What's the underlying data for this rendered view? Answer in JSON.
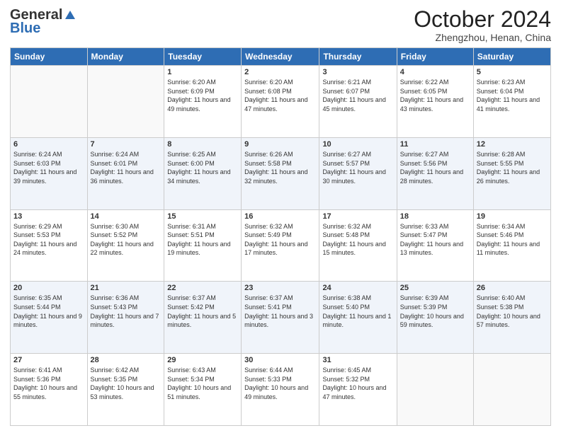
{
  "header": {
    "logo_line1": "General",
    "logo_line2": "Blue",
    "month": "October 2024",
    "location": "Zhengzhou, Henan, China"
  },
  "weekdays": [
    "Sunday",
    "Monday",
    "Tuesday",
    "Wednesday",
    "Thursday",
    "Friday",
    "Saturday"
  ],
  "weeks": [
    [
      {
        "day": "",
        "info": ""
      },
      {
        "day": "",
        "info": ""
      },
      {
        "day": "1",
        "sunrise": "6:20 AM",
        "sunset": "6:09 PM",
        "daylight": "11 hours and 49 minutes."
      },
      {
        "day": "2",
        "sunrise": "6:20 AM",
        "sunset": "6:08 PM",
        "daylight": "11 hours and 47 minutes."
      },
      {
        "day": "3",
        "sunrise": "6:21 AM",
        "sunset": "6:07 PM",
        "daylight": "11 hours and 45 minutes."
      },
      {
        "day": "4",
        "sunrise": "6:22 AM",
        "sunset": "6:05 PM",
        "daylight": "11 hours and 43 minutes."
      },
      {
        "day": "5",
        "sunrise": "6:23 AM",
        "sunset": "6:04 PM",
        "daylight": "11 hours and 41 minutes."
      }
    ],
    [
      {
        "day": "6",
        "sunrise": "6:24 AM",
        "sunset": "6:03 PM",
        "daylight": "11 hours and 39 minutes."
      },
      {
        "day": "7",
        "sunrise": "6:24 AM",
        "sunset": "6:01 PM",
        "daylight": "11 hours and 36 minutes."
      },
      {
        "day": "8",
        "sunrise": "6:25 AM",
        "sunset": "6:00 PM",
        "daylight": "11 hours and 34 minutes."
      },
      {
        "day": "9",
        "sunrise": "6:26 AM",
        "sunset": "5:58 PM",
        "daylight": "11 hours and 32 minutes."
      },
      {
        "day": "10",
        "sunrise": "6:27 AM",
        "sunset": "5:57 PM",
        "daylight": "11 hours and 30 minutes."
      },
      {
        "day": "11",
        "sunrise": "6:27 AM",
        "sunset": "5:56 PM",
        "daylight": "11 hours and 28 minutes."
      },
      {
        "day": "12",
        "sunrise": "6:28 AM",
        "sunset": "5:55 PM",
        "daylight": "11 hours and 26 minutes."
      }
    ],
    [
      {
        "day": "13",
        "sunrise": "6:29 AM",
        "sunset": "5:53 PM",
        "daylight": "11 hours and 24 minutes."
      },
      {
        "day": "14",
        "sunrise": "6:30 AM",
        "sunset": "5:52 PM",
        "daylight": "11 hours and 22 minutes."
      },
      {
        "day": "15",
        "sunrise": "6:31 AM",
        "sunset": "5:51 PM",
        "daylight": "11 hours and 19 minutes."
      },
      {
        "day": "16",
        "sunrise": "6:32 AM",
        "sunset": "5:49 PM",
        "daylight": "11 hours and 17 minutes."
      },
      {
        "day": "17",
        "sunrise": "6:32 AM",
        "sunset": "5:48 PM",
        "daylight": "11 hours and 15 minutes."
      },
      {
        "day": "18",
        "sunrise": "6:33 AM",
        "sunset": "5:47 PM",
        "daylight": "11 hours and 13 minutes."
      },
      {
        "day": "19",
        "sunrise": "6:34 AM",
        "sunset": "5:46 PM",
        "daylight": "11 hours and 11 minutes."
      }
    ],
    [
      {
        "day": "20",
        "sunrise": "6:35 AM",
        "sunset": "5:44 PM",
        "daylight": "11 hours and 9 minutes."
      },
      {
        "day": "21",
        "sunrise": "6:36 AM",
        "sunset": "5:43 PM",
        "daylight": "11 hours and 7 minutes."
      },
      {
        "day": "22",
        "sunrise": "6:37 AM",
        "sunset": "5:42 PM",
        "daylight": "11 hours and 5 minutes."
      },
      {
        "day": "23",
        "sunrise": "6:37 AM",
        "sunset": "5:41 PM",
        "daylight": "11 hours and 3 minutes."
      },
      {
        "day": "24",
        "sunrise": "6:38 AM",
        "sunset": "5:40 PM",
        "daylight": "11 hours and 1 minute."
      },
      {
        "day": "25",
        "sunrise": "6:39 AM",
        "sunset": "5:39 PM",
        "daylight": "10 hours and 59 minutes."
      },
      {
        "day": "26",
        "sunrise": "6:40 AM",
        "sunset": "5:38 PM",
        "daylight": "10 hours and 57 minutes."
      }
    ],
    [
      {
        "day": "27",
        "sunrise": "6:41 AM",
        "sunset": "5:36 PM",
        "daylight": "10 hours and 55 minutes."
      },
      {
        "day": "28",
        "sunrise": "6:42 AM",
        "sunset": "5:35 PM",
        "daylight": "10 hours and 53 minutes."
      },
      {
        "day": "29",
        "sunrise": "6:43 AM",
        "sunset": "5:34 PM",
        "daylight": "10 hours and 51 minutes."
      },
      {
        "day": "30",
        "sunrise": "6:44 AM",
        "sunset": "5:33 PM",
        "daylight": "10 hours and 49 minutes."
      },
      {
        "day": "31",
        "sunrise": "6:45 AM",
        "sunset": "5:32 PM",
        "daylight": "10 hours and 47 minutes."
      },
      {
        "day": "",
        "info": ""
      },
      {
        "day": "",
        "info": ""
      }
    ]
  ]
}
